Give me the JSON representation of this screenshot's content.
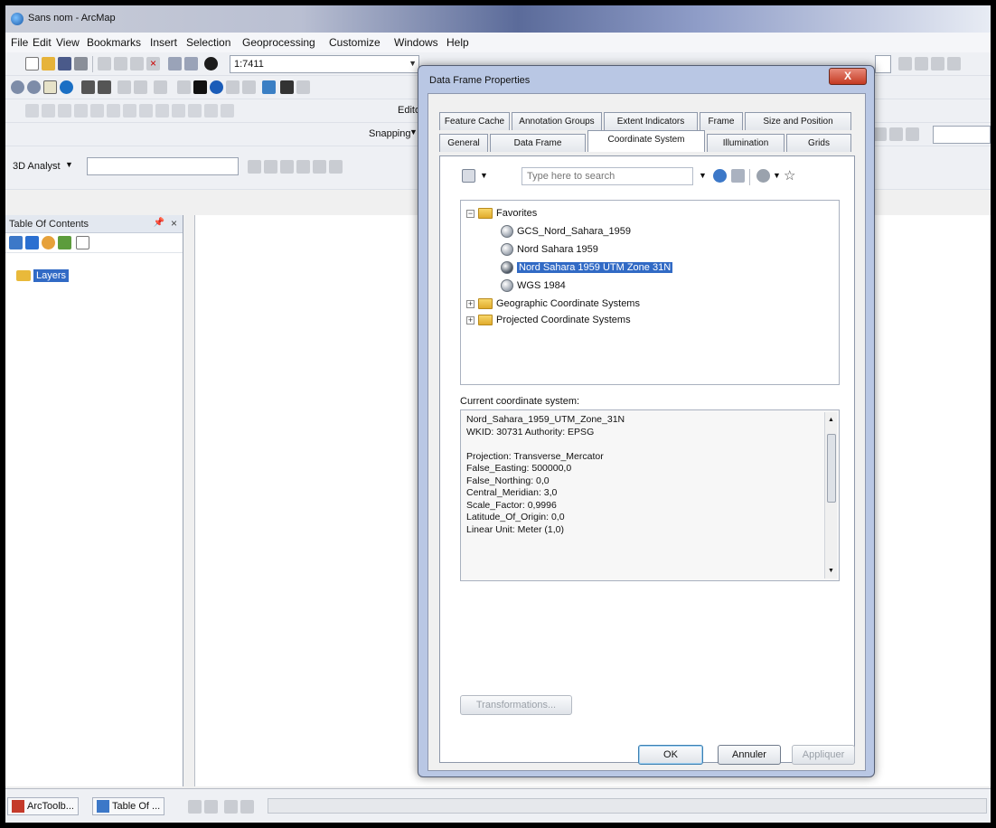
{
  "window": {
    "title": "Sans nom - ArcMap"
  },
  "menu": [
    "File",
    "Edit",
    "View",
    "Bookmarks",
    "Insert",
    "Selection",
    "Geoprocessing",
    "Customize",
    "Windows",
    "Help"
  ],
  "toolbar": {
    "scale_value": "1:7411",
    "editor_label": "Edito",
    "snapping_label": "Snapping",
    "analyst_label": "3D Analyst"
  },
  "toc": {
    "title": "Table Of Contents",
    "layers_label": "Layers"
  },
  "statusbar": {
    "arctoolbox_tab": "ArcToolb...",
    "toc_tab": "Table Of ..."
  },
  "dialog": {
    "title": "Data Frame Properties",
    "close_label": "X",
    "tabs_row1": [
      "Feature Cache",
      "Annotation Groups",
      "Extent Indicators",
      "Frame",
      "Size and Position"
    ],
    "tabs_row2": [
      "General",
      "Data Frame",
      "Coordinate System",
      "Illumination",
      "Grids"
    ],
    "active_tab": "Coordinate System",
    "search_placeholder": "Type here to search",
    "tree": {
      "favorites_label": "Favorites",
      "favorites": [
        "GCS_Nord_Sahara_1959",
        "Nord Sahara 1959",
        "Nord Sahara 1959 UTM Zone 31N",
        "WGS 1984"
      ],
      "selected": "Nord Sahara 1959 UTM Zone 31N",
      "folders": [
        "Geographic Coordinate Systems",
        "Projected Coordinate Systems"
      ]
    },
    "current_label": "Current coordinate system:",
    "current_lines": [
      "Nord_Sahara_1959_UTM_Zone_31N",
      "WKID: 30731 Authority: EPSG",
      "",
      "Projection: Transverse_Mercator",
      "False_Easting: 500000,0",
      "False_Northing: 0,0",
      "Central_Meridian: 3,0",
      "Scale_Factor: 0,9996",
      "Latitude_Of_Origin: 0,0",
      "Linear Unit: Meter (1,0)"
    ],
    "buttons": {
      "transformations": "Transformations...",
      "ok": "OK",
      "cancel": "Annuler",
      "apply": "Appliquer"
    }
  }
}
